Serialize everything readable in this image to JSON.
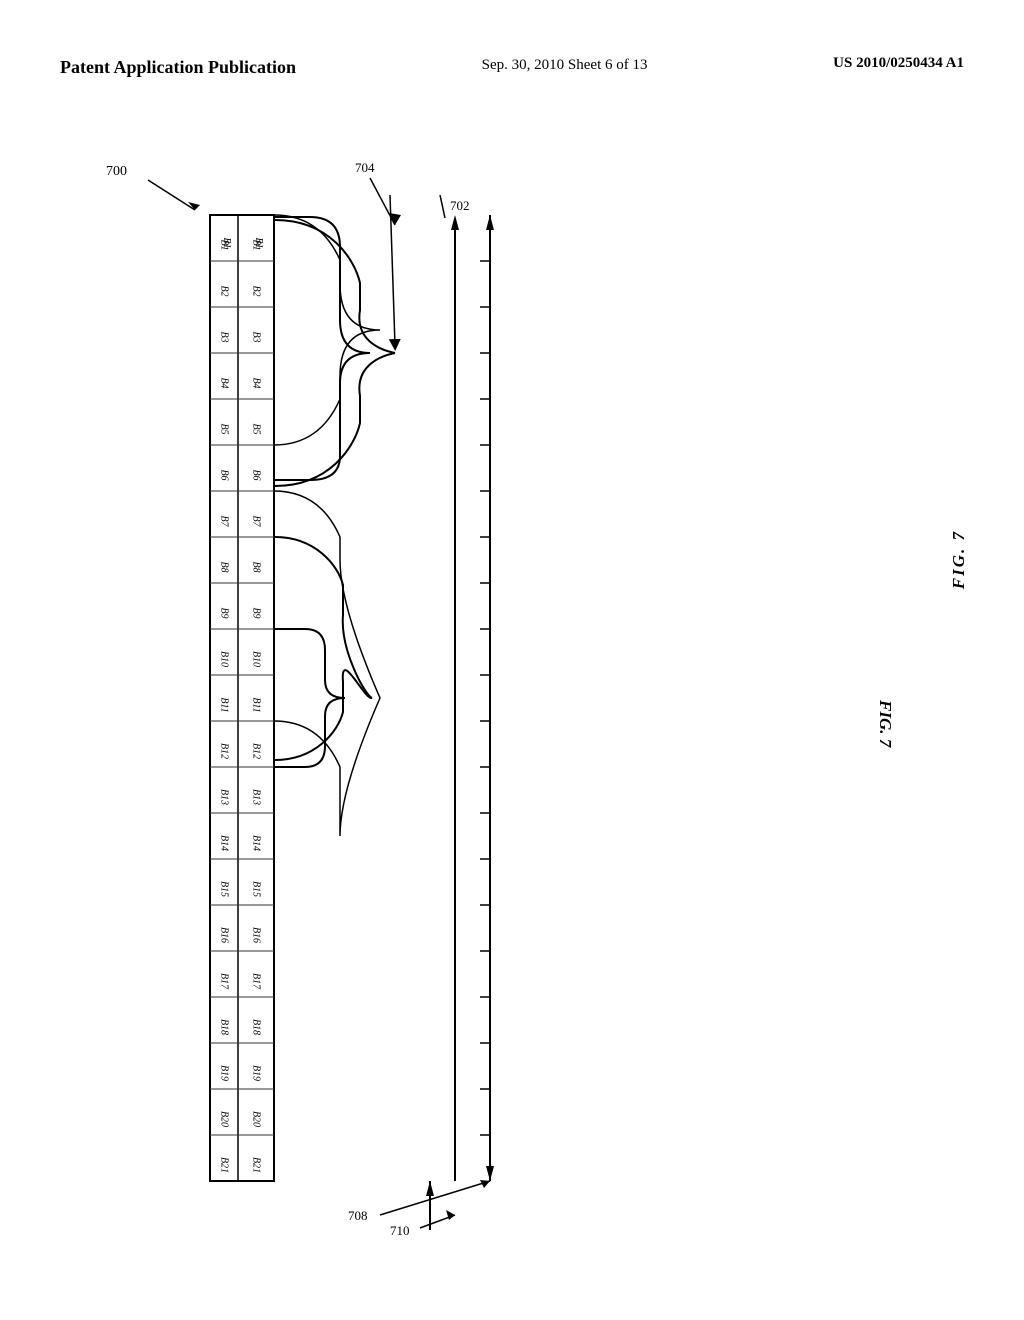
{
  "header": {
    "left": "Patent Application Publication",
    "center": "Sep. 30, 2010   Sheet 6 of 13",
    "right": "US 2010/0250434 A1"
  },
  "figure": {
    "label": "FIG. 7",
    "number": "7"
  },
  "labels": {
    "l700": "700",
    "l702": "702",
    "l704": "704",
    "l708": "708",
    "l710": "710"
  },
  "blocks": [
    "B1",
    "B2",
    "B3",
    "B4",
    "B5",
    "B6",
    "B7",
    "B8",
    "B9",
    "B10",
    "B11",
    "B12",
    "B13",
    "B14",
    "B15",
    "B16",
    "B17",
    "B18",
    "B19",
    "B20",
    "B21"
  ]
}
